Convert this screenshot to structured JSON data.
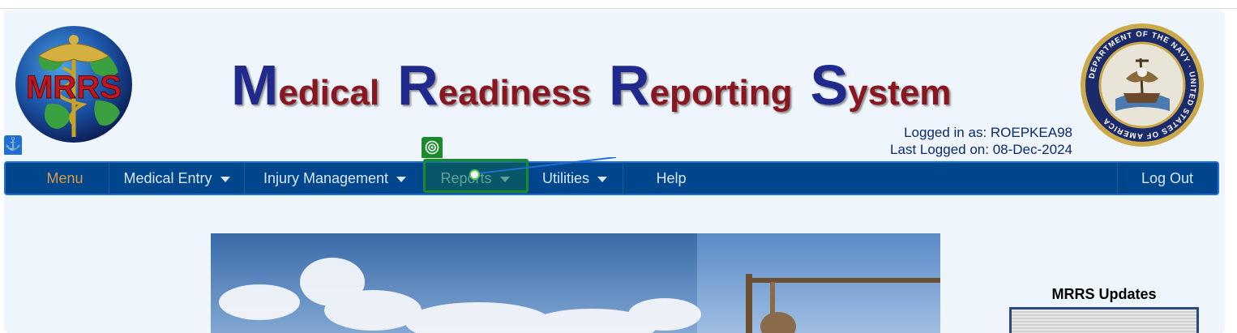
{
  "header": {
    "logo_text": "MRRS",
    "title_words": [
      {
        "cap": "M",
        "rest": "edical"
      },
      {
        "cap": "R",
        "rest": "eadiness"
      },
      {
        "cap": "R",
        "rest": "eporting"
      },
      {
        "cap": "S",
        "rest": "ystem"
      }
    ],
    "seal_text": "DEPARTMENT OF THE NAVY · UNITED STATES OF AMERICA",
    "login_line1": "Logged in as: ROEPKEA98",
    "login_line2": "Last Logged on: 08-Dec-2024"
  },
  "nav": {
    "items": [
      {
        "label": "Menu",
        "has_dropdown": false
      },
      {
        "label": "Medical Entry",
        "has_dropdown": true
      },
      {
        "label": "Injury Management",
        "has_dropdown": true
      },
      {
        "label": "Reports",
        "has_dropdown": true
      },
      {
        "label": "Utilities",
        "has_dropdown": true
      },
      {
        "label": "Help",
        "has_dropdown": false
      }
    ],
    "logout_label": "Log Out"
  },
  "sidebar": {
    "updates_title": "MRRS Updates"
  },
  "colors": {
    "nav_bg": "#00468c",
    "page_bg": "#eef5fc",
    "title_cap": "#1f2a8c",
    "title_rest": "#8a1620",
    "menu_accent": "#d89a4a"
  }
}
